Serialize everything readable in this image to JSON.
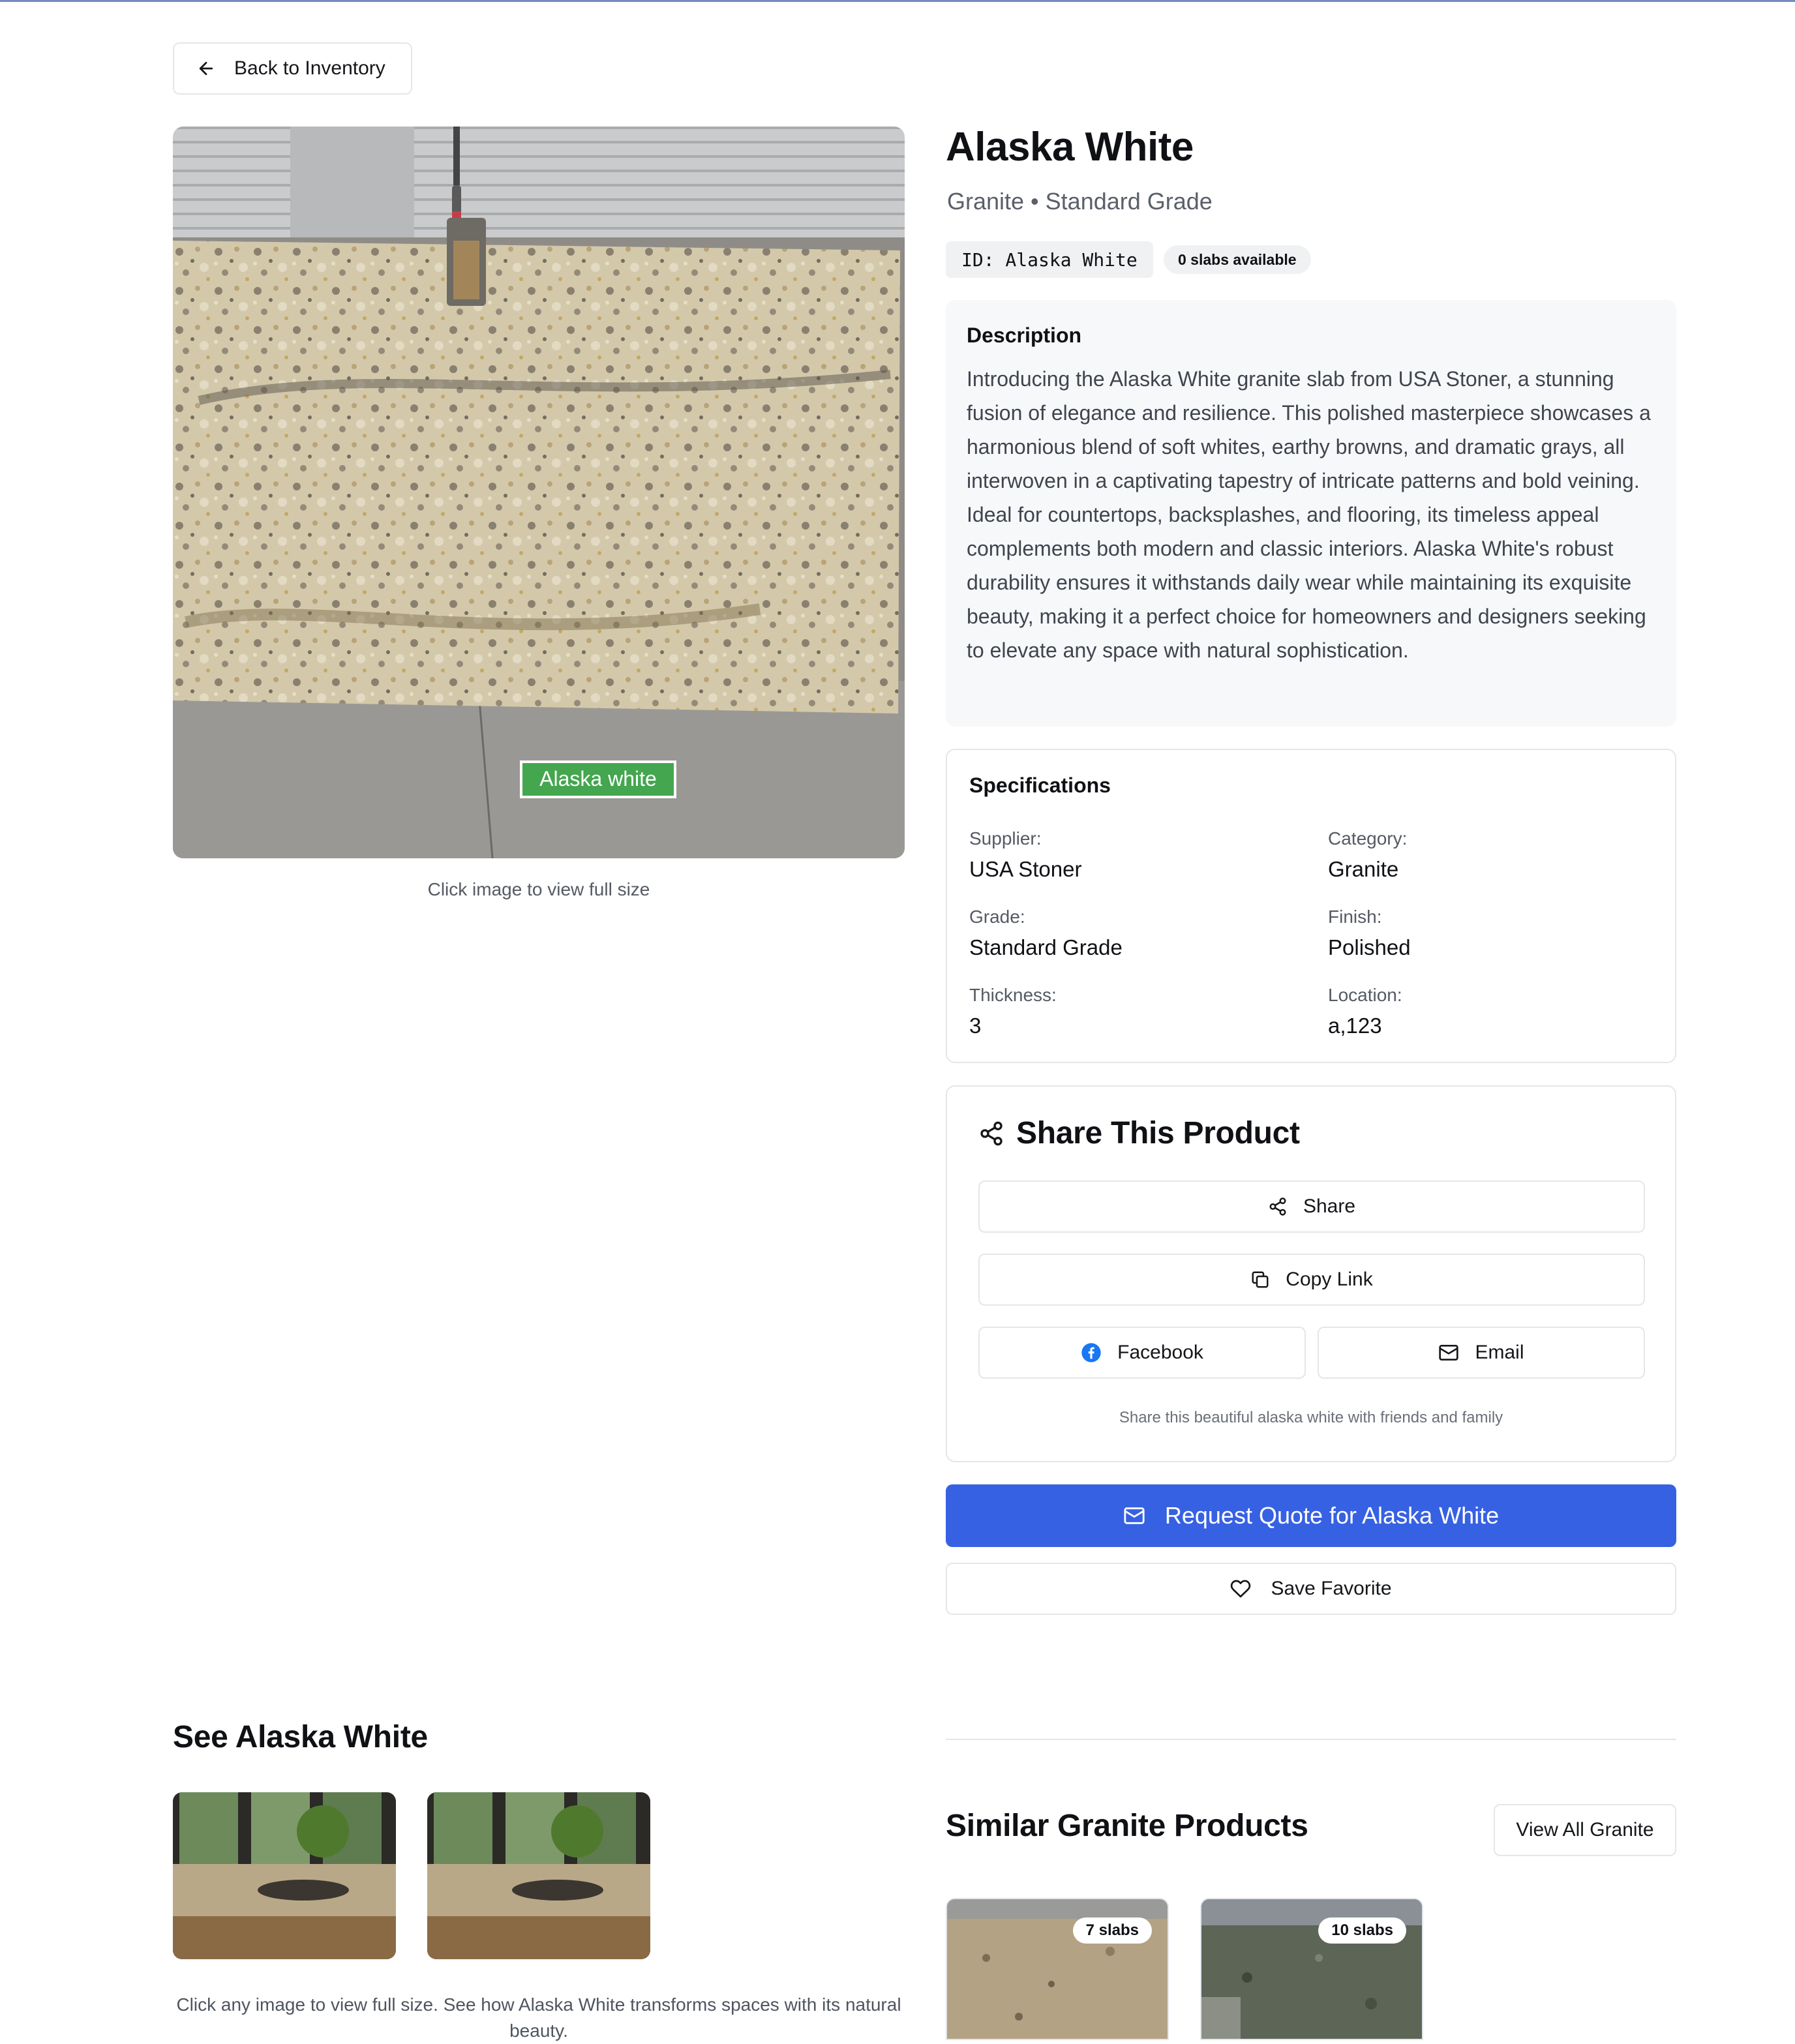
{
  "nav": {
    "back_label": "Back to Inventory"
  },
  "product": {
    "name": "Alaska White",
    "subtitle": "Granite • Standard Grade",
    "id_badge": "ID: Alaska White",
    "slabs_badge": "0 slabs available",
    "image_label": "Alaska white",
    "image_caption": "Click image to view full size"
  },
  "description": {
    "title": "Description",
    "text": "Introducing the Alaska White granite slab from USA Stoner, a stunning fusion of elegance and resilience. This polished masterpiece showcases a harmonious blend of soft whites, earthy browns, and dramatic grays, all interwoven in a captivating tapestry of intricate patterns and bold veining. Ideal for countertops, backsplashes, and flooring, its timeless appeal complements both modern and classic interiors. Alaska White's robust durability ensures it withstands daily wear while maintaining its exquisite beauty, making it a perfect choice for homeowners and designers seeking to elevate any space with natural sophistication."
  },
  "specs": {
    "title": "Specifications",
    "items": [
      {
        "label": "Supplier:",
        "value": "USA Stoner"
      },
      {
        "label": "Category:",
        "value": "Granite"
      },
      {
        "label": "Grade:",
        "value": "Standard Grade"
      },
      {
        "label": "Finish:",
        "value": "Polished"
      },
      {
        "label": "Thickness:",
        "value": "3"
      },
      {
        "label": "Location:",
        "value": "a,123"
      }
    ]
  },
  "share": {
    "title": "Share This Product",
    "share_label": "Share",
    "copy_label": "Copy Link",
    "facebook_label": "Facebook",
    "email_label": "Email",
    "note": "Share this beautiful alaska white with friends and family"
  },
  "actions": {
    "quote_label": "Request Quote for Alaska White",
    "favorite_label": "Save Favorite",
    "accent_color": "#3761e3"
  },
  "see": {
    "title": "See Alaska White",
    "caption": "Click any image to view full size. See how Alaska White transforms spaces with its natural beauty."
  },
  "similar": {
    "title": "Similar Granite Products",
    "view_all_label": "View All Granite",
    "items": [
      {
        "badge": "7 slabs"
      },
      {
        "badge": "10 slabs"
      }
    ]
  }
}
